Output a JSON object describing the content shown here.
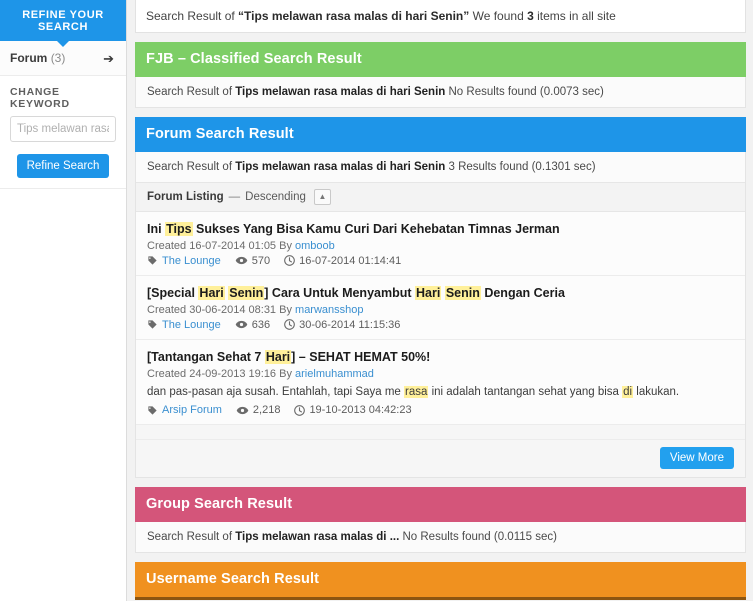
{
  "sidebar": {
    "header": "REFINE YOUR SEARCH",
    "facet": {
      "label": "Forum",
      "count": "(3)",
      "arrow": "➔"
    },
    "change_keyword_label": "CHANGE KEYWORD",
    "keyword_input": {
      "value": "",
      "placeholder": "Tips melawan rasa malas di hari Senin"
    },
    "refine_button": "Refine Search"
  },
  "topbar": {
    "prefix": "Search Result of ",
    "query_quoted": "“Tips melawan rasa malas di hari Senin”",
    "suffix_pre": " We found ",
    "count": "3",
    "suffix_post": " items in all site"
  },
  "panels": {
    "fjb": {
      "title": "FJB – Classified Search Result",
      "color": "#7dce66",
      "summary_prefix": "Search Result of ",
      "summary_query": "Tips melawan rasa malas di hari Senin",
      "summary_suffix": " No Results found (0.0073 sec)"
    },
    "forum": {
      "title": "Forum Search Result",
      "color": "#1e95e8",
      "summary_prefix": "Search Result of ",
      "summary_query": "Tips melawan rasa malas di hari Senin",
      "summary_suffix": " 3 Results found (0.1301 sec)",
      "listing": {
        "title": "Forum Listing",
        "dash": "—",
        "direction": "Descending",
        "sort_icon": "▲"
      },
      "view_more": "View More",
      "results": [
        {
          "title_parts": [
            {
              "t": "Ini ",
              "hl": false
            },
            {
              "t": "Tips",
              "hl": true
            },
            {
              "t": " Sukses Yang Bisa Kamu Curi Dari Kehebatan Timnas Jerman",
              "hl": false
            }
          ],
          "created_label": "Created",
          "created_date": "16-07-2014 01:05",
          "by_label": "By",
          "author": "omboob",
          "forum": "The Lounge",
          "views": "570",
          "last_post": "16-07-2014 01:14:41",
          "snippet_parts": []
        },
        {
          "title_parts": [
            {
              "t": "[Special ",
              "hl": false
            },
            {
              "t": "Hari",
              "hl": true
            },
            {
              "t": " ",
              "hl": false
            },
            {
              "t": "Senin",
              "hl": true
            },
            {
              "t": "] Cara Untuk Menyambut ",
              "hl": false
            },
            {
              "t": "Hari",
              "hl": true
            },
            {
              "t": " ",
              "hl": false
            },
            {
              "t": "Senin",
              "hl": true
            },
            {
              "t": " Dengan Ceria",
              "hl": false
            }
          ],
          "created_label": "Created",
          "created_date": "30-06-2014 08:31",
          "by_label": "By",
          "author": "marwansshop",
          "forum": "The Lounge",
          "views": "636",
          "last_post": "30-06-2014 11:15:36",
          "snippet_parts": []
        },
        {
          "title_parts": [
            {
              "t": "[Tantangan Sehat 7 ",
              "hl": false
            },
            {
              "t": "Hari",
              "hl": true
            },
            {
              "t": "] – SEHAT HEMAT 50%!",
              "hl": false
            }
          ],
          "created_label": "Created",
          "created_date": "24-09-2013 19:16",
          "by_label": "By",
          "author": "arielmuhammad",
          "forum": "Arsip Forum",
          "views": "2,218",
          "last_post": "19-10-2013 04:42:23",
          "snippet_parts": [
            {
              "t": "dan pas-pasan aja susah. Entahlah, tapi Saya me ",
              "hl": false
            },
            {
              "t": "rasa",
              "hl": true
            },
            {
              "t": " ini adalah tantangan sehat yang bisa ",
              "hl": false
            },
            {
              "t": "di",
              "hl": true
            },
            {
              "t": " lakukan.",
              "hl": false
            }
          ]
        }
      ]
    },
    "group": {
      "title": "Group Search Result",
      "color": "#d4557a",
      "summary_prefix": "Search Result of ",
      "summary_query": "Tips melawan rasa malas di ...",
      "summary_suffix": " No Results found (0.0115 sec)"
    },
    "username": {
      "title": "Username Search Result",
      "color": "#f0911f"
    }
  }
}
